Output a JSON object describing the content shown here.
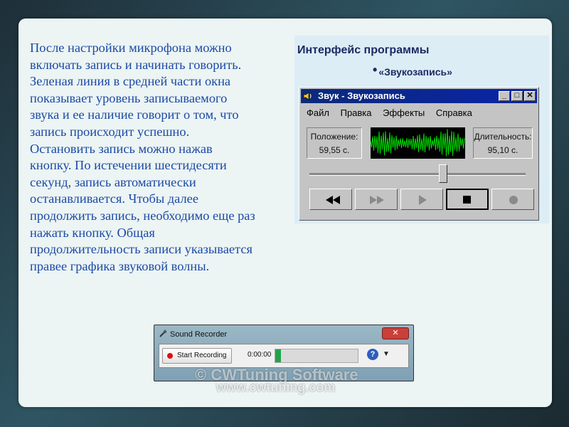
{
  "slide": {
    "paragraph": "После настройки микрофона можно\nвключать запись и начинать говорить.\nЗеленая линия в средней части окна\nпоказывает уровень записываемого\nзвука и ее наличие говорит о том, что\nзапись происходит успешно.\nОстановить запись можно нажав\nкнопку. По истечении шестидесяти\nсекунд, запись автоматически\nостанавливается. Чтобы далее\nпродолжить запись, необходимо еще раз\nнажать кнопку. Общая\nпродолжительность записи указывается\nправее графика звуковой волны."
  },
  "panel": {
    "title": "Интерфейс программы",
    "subtitle": "«Звукозапись»"
  },
  "old_recorder": {
    "title": "Звук - Звукозапись",
    "menu": [
      "Файл",
      "Правка",
      "Эффекты",
      "Справка"
    ],
    "position_label": "Положение:",
    "position_value": "59,55 с.",
    "duration_label": "Длительность:",
    "duration_value": "95,10 с.",
    "slider_level": 0.62,
    "wave_color": "#00e000"
  },
  "sound_recorder": {
    "title": "Sound Recorder",
    "start_button": "Start Recording",
    "time": "0:00:00",
    "level_fill": 0.07,
    "close_glyph": "✕",
    "help_glyph": "?"
  },
  "watermark": {
    "line1": "© CWTuning Software",
    "line2": "www.cwtuning.com"
  }
}
